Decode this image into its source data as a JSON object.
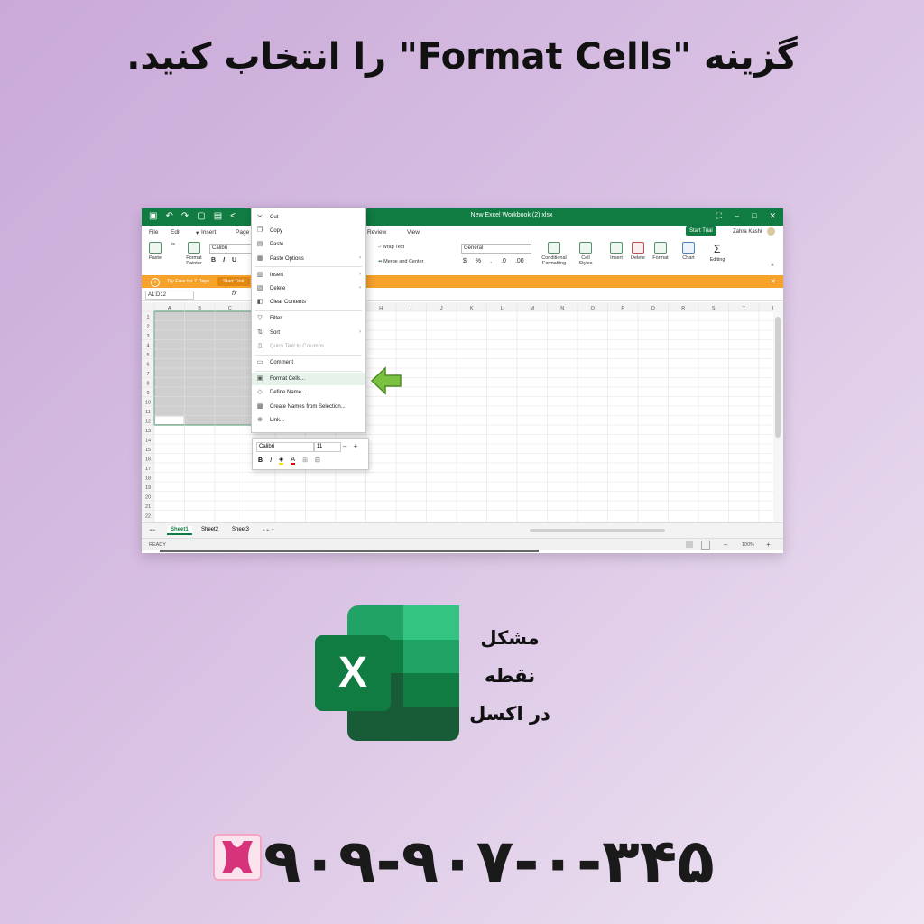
{
  "headline": "گزینه \"Format Cells\" را انتخاب کنید.",
  "excel": {
    "doc_title": "New Excel Workbook (2).xlsx",
    "menus": [
      "File",
      "Edit",
      "Insert",
      "Page",
      "Review",
      "View"
    ],
    "start_trial": "Start Trial",
    "user_name": "Zahra Kashi",
    "ribbon": {
      "paste": "Paste",
      "format_painter": "Format Painter",
      "font_name": "Calibri",
      "bold": "B",
      "italic": "I",
      "underline": "U",
      "wrap_text": "Wrap Text",
      "merge_center": "Merge and Center",
      "number_format": "General",
      "conditional": "Conditional Formatting",
      "cell_styles": "Cell Styles",
      "insert": "Insert",
      "delete": "Delete",
      "format": "Format",
      "chart": "Chart",
      "editing": "Editing"
    },
    "trial_bar": {
      "text": "Try Free for 7 Days",
      "button": "Start Trial"
    },
    "name_box": "A1:D12",
    "columns": [
      "A",
      "B",
      "C",
      "D",
      "E",
      "F",
      "G",
      "H",
      "I",
      "J",
      "K",
      "L",
      "M",
      "N",
      "O",
      "P",
      "Q",
      "R",
      "S",
      "T",
      "U"
    ],
    "rows": [
      "1",
      "2",
      "3",
      "4",
      "5",
      "6",
      "7",
      "8",
      "9",
      "10",
      "11",
      "12",
      "13",
      "14",
      "15",
      "16",
      "17",
      "18",
      "19",
      "20",
      "21",
      "22"
    ],
    "sheets": [
      "Sheet1",
      "Sheet2",
      "Sheet3"
    ],
    "status": "READY",
    "zoom": "100%",
    "context_menu": [
      {
        "label": "Cut",
        "icon": "scissors-icon",
        "glyph": "✂"
      },
      {
        "label": "Copy",
        "icon": "copy-icon",
        "glyph": "❐"
      },
      {
        "label": "Paste",
        "icon": "paste-icon",
        "glyph": "▤"
      },
      {
        "label": "Paste Options",
        "icon": "paste-options-icon",
        "glyph": "▦",
        "arrow": true
      },
      {
        "label": "Insert",
        "icon": "insert-icon",
        "glyph": "▥",
        "arrow": true
      },
      {
        "label": "Delete",
        "icon": "delete-icon",
        "glyph": "▧",
        "arrow": true
      },
      {
        "label": "Clear Contents",
        "icon": "clear-icon",
        "glyph": "◧"
      },
      {
        "label": "Filter",
        "icon": "filter-icon",
        "glyph": "▽"
      },
      {
        "label": "Sort",
        "icon": "sort-icon",
        "glyph": "⇅",
        "arrow": true
      },
      {
        "label": "Quick Text to Columns",
        "icon": "text-columns-icon",
        "glyph": "▯",
        "disabled": true
      },
      {
        "label": "Comment",
        "icon": "comment-icon",
        "glyph": "▭"
      },
      {
        "label": "Format Cells...",
        "icon": "format-cells-icon",
        "glyph": "▣",
        "highlight": true
      },
      {
        "label": "Define Name...",
        "icon": "tag-icon",
        "glyph": "◇"
      },
      {
        "label": "Create Names from Selection...",
        "icon": "names-icon",
        "glyph": "▩"
      },
      {
        "label": "Link...",
        "icon": "link-icon",
        "glyph": "⊕"
      }
    ],
    "mini_toolbar": {
      "font": "Calibri",
      "size": "11"
    }
  },
  "promo": {
    "logo_letter": "X",
    "side_text": [
      "مشکل",
      "نقطه",
      "در اکسل"
    ],
    "phone": "۹۰۹-۹۰۷-۰-۳۴۵"
  },
  "colors": {
    "excel_green": "#107c41",
    "trial_orange": "#f6a22b",
    "arrow_green": "#7ac142",
    "brand_pink": "#d6337a"
  }
}
